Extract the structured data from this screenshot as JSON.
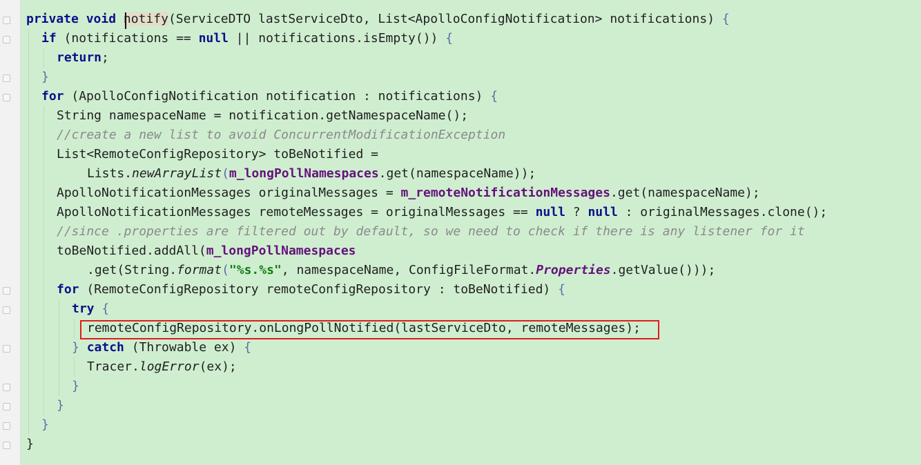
{
  "editor": {
    "language": "java",
    "highlight_color": "#e11b1b",
    "background_color": "#cfeed0",
    "highlighted_line_index": 16,
    "lines": [
      "private void notify(ServiceDTO lastServiceDto, List<ApolloConfigNotification> notifications) {",
      "  if (notifications == null || notifications.isEmpty()) {",
      "    return;",
      "  }",
      "  for (ApolloConfigNotification notification : notifications) {",
      "    String namespaceName = notification.getNamespaceName();",
      "    //create a new list to avoid ConcurrentModificationException",
      "    List<RemoteConfigRepository> toBeNotified =",
      "        Lists.newArrayList(m_longPollNamespaces.get(namespaceName));",
      "    ApolloNotificationMessages originalMessages = m_remoteNotificationMessages.get(namespaceName);",
      "    ApolloNotificationMessages remoteMessages = originalMessages == null ? null : originalMessages.clone();",
      "    //since .properties are filtered out by default, so we need to check if there is any listener for it",
      "    toBeNotified.addAll(m_longPollNamespaces",
      "        .get(String.format(\"%s.%s\", namespaceName, ConfigFileFormat.Properties.getValue())));",
      "    for (RemoteConfigRepository remoteConfigRepository : toBeNotified) {",
      "      try {",
      "        remoteConfigRepository.onLongPollNotified(lastServiceDto, remoteMessages);",
      "      } catch (Throwable ex) {",
      "        Tracer.logError(ex);",
      "      }",
      "    }",
      "  }",
      "}"
    ],
    "tokens": {
      "l0": {
        "a": "private",
        "b": "void",
        "c": "notify",
        "d": "(ServiceDTO lastServiceDto, List<ApolloConfigNotification> notifications) ",
        "e": "{"
      },
      "l1": {
        "a": "if",
        "b": " (notifications == ",
        "c": "null",
        "d": " || notifications.isEmpty()) ",
        "e": "{"
      },
      "l2": {
        "a": "return",
        ";": ";"
      },
      "l3": {
        "a": "}"
      },
      "l4": {
        "a": "for",
        "b": " (ApolloConfigNotification notification : notifications) ",
        "e": "{"
      },
      "l5": {
        "a": "String namespaceName = notification.getNamespaceName();"
      },
      "l6": {
        "a": "//create a new list to avoid ConcurrentModificationException"
      },
      "l7": {
        "a": "List<RemoteConfigRepository> toBeNotified ="
      },
      "l8": {
        "a": "Lists.",
        "b": "newArrayList",
        "c": "(",
        "d": "m_longPollNamespaces",
        "e": ".get(namespaceName));"
      },
      "l9": {
        "a": "ApolloNotificationMessages originalMessages = ",
        "b": "m_remoteNotificationMessages",
        "c": ".get(namespaceName);"
      },
      "l10": {
        "a": "ApolloNotificationMessages remoteMessages = originalMessages == ",
        "b": "null",
        "c": " ? ",
        "d": "null",
        "e": " : originalMessages.clone();"
      },
      "l11": {
        "a": "//since .properties are filtered out by default, so we need to check if there is any listener for it"
      },
      "l12": {
        "a": "toBeNotified.addAll(",
        "b": "m_longPollNamespaces"
      },
      "l13": {
        "a": ".get(String.",
        "b": "format",
        "c": "(",
        "d": "\"%s.%s\"",
        "e": ", namespaceName, ConfigFileFormat.",
        "f": "Properties",
        "g": ".getValue()));"
      },
      "l14": {
        "a": "for",
        "b": " (RemoteConfigRepository remoteConfigRepository : toBeNotified) ",
        "e": "{"
      },
      "l15": {
        "a": "try",
        "e": " {"
      },
      "l16": {
        "a": "remoteConfigRepository.onLongPollNotified(lastServiceDto, remoteMessages);"
      },
      "l17": {
        "a": "} ",
        "b": "catch",
        "c": " (Throwable ex) ",
        "e": "{"
      },
      "l18": {
        "a": "Tracer.",
        "b": "logError",
        "c": "(ex);"
      },
      "l19": {
        "a": "}"
      },
      "l20": {
        "a": "}"
      },
      "l21": {
        "a": "}"
      },
      "l22": {
        "a": "}"
      }
    }
  }
}
